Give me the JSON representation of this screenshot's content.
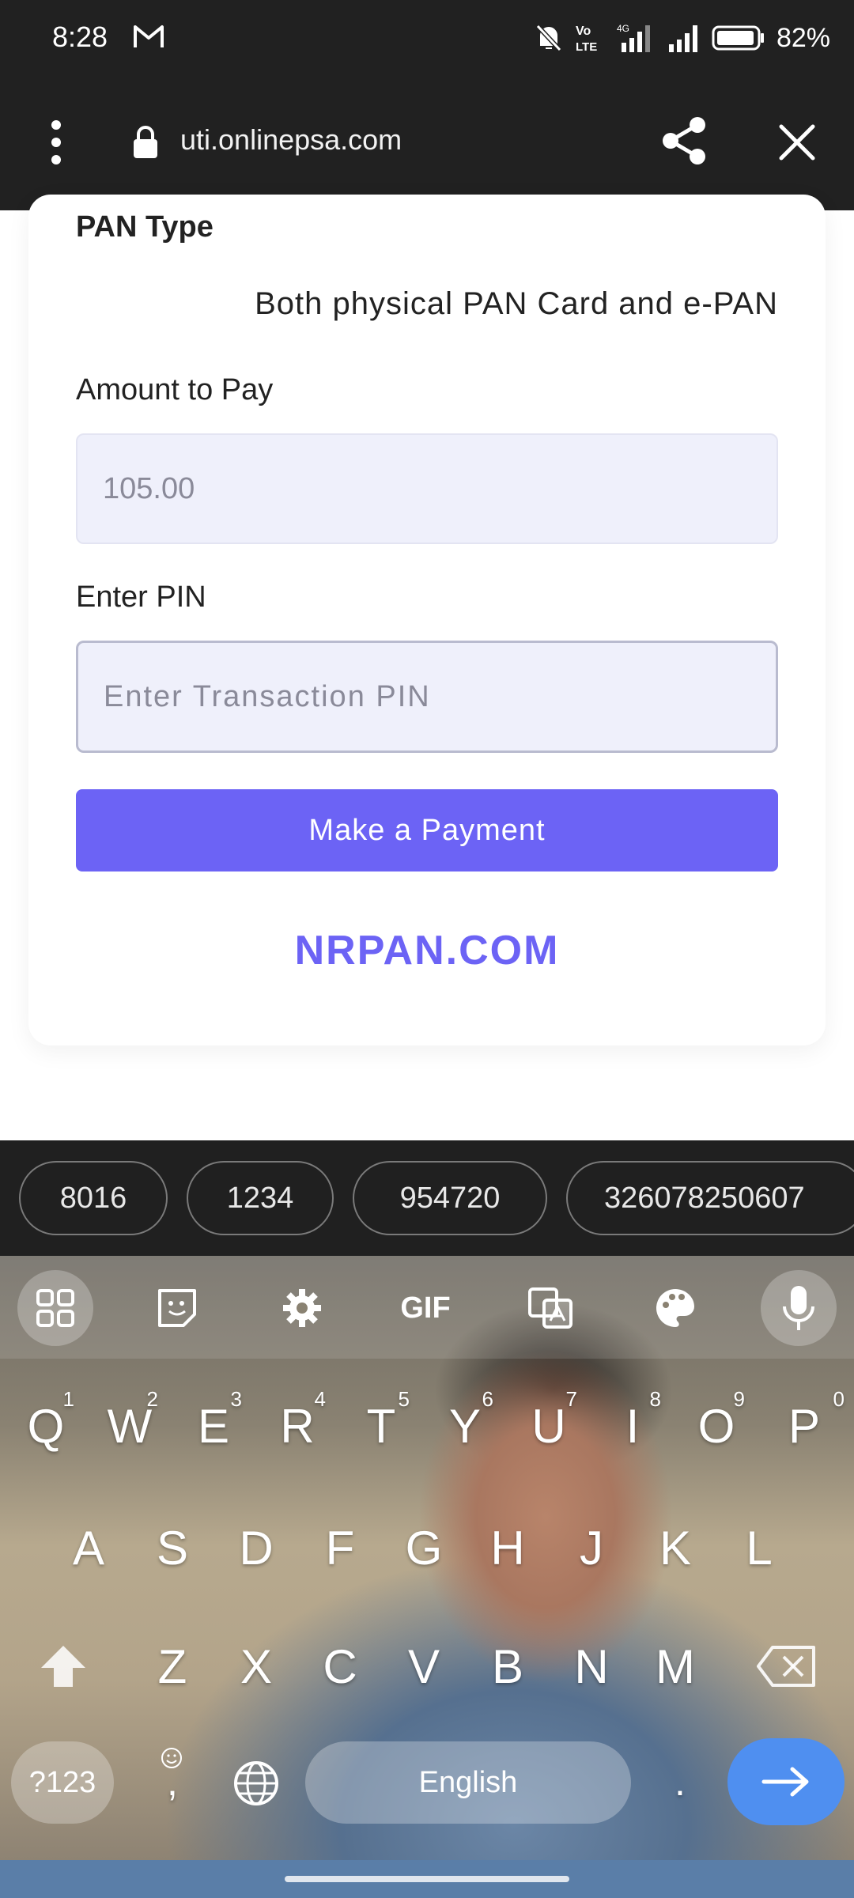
{
  "status_bar": {
    "time": "8:28",
    "battery": "82%"
  },
  "browser": {
    "url": "uti.onlinepsa.com"
  },
  "form": {
    "pan_type_label": "PAN Type",
    "pan_type_value": "Both physical PAN Card and e-PAN",
    "amount_label": "Amount to Pay",
    "amount_value": "105.00",
    "pin_label": "Enter PIN",
    "pin_placeholder": "Enter Transaction PIN",
    "pay_button_label": "Make a Payment",
    "brand": "NRPAN.COM"
  },
  "keyboard": {
    "suggestions": [
      "8016",
      "1234",
      "954720",
      "326078250607"
    ],
    "tool_gif_label": "GIF",
    "row1": [
      {
        "key": "Q",
        "hint": "1"
      },
      {
        "key": "W",
        "hint": "2"
      },
      {
        "key": "E",
        "hint": "3"
      },
      {
        "key": "R",
        "hint": "4"
      },
      {
        "key": "T",
        "hint": "5"
      },
      {
        "key": "Y",
        "hint": "6"
      },
      {
        "key": "U",
        "hint": "7"
      },
      {
        "key": "I",
        "hint": "8"
      },
      {
        "key": "O",
        "hint": "9"
      },
      {
        "key": "P",
        "hint": "0"
      }
    ],
    "row2": [
      "A",
      "S",
      "D",
      "F",
      "G",
      "H",
      "J",
      "K",
      "L"
    ],
    "row3": [
      "Z",
      "X",
      "C",
      "V",
      "B",
      "N",
      "M"
    ],
    "num_key_label": "?123",
    "comma_label": ",",
    "space_label": "English",
    "period_label": ".",
    "accent_color": "#4f8ff0"
  },
  "colors": {
    "primary": "#6c63f5",
    "status_bar": "#212121"
  }
}
